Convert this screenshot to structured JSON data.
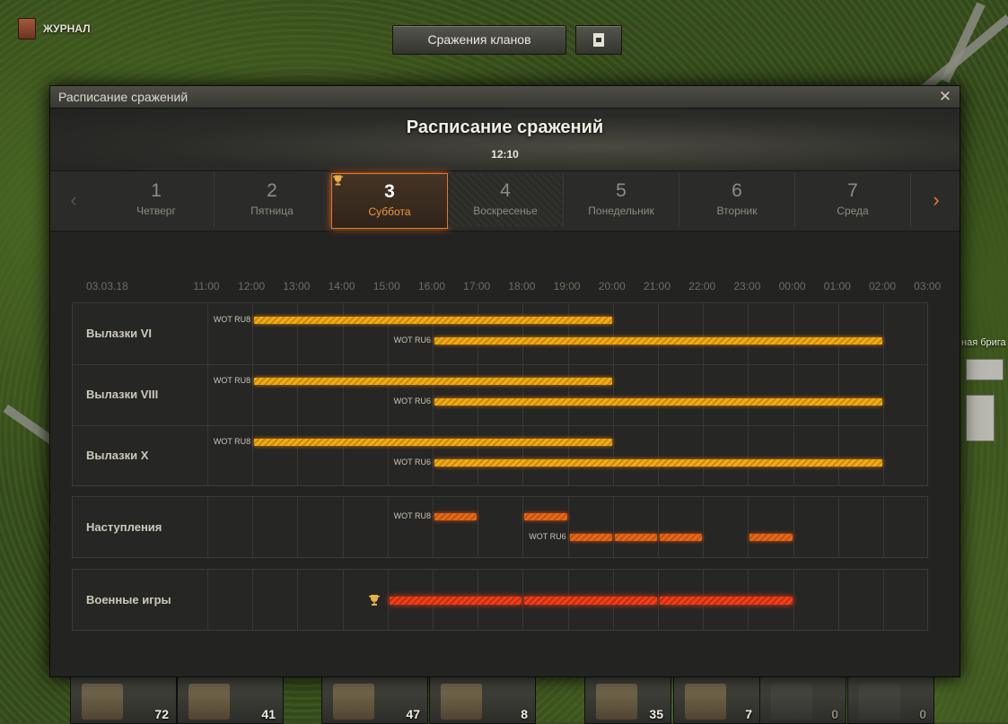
{
  "topbar": {
    "journal_label": "ЖУРНАЛ",
    "clan_battles_button": "Сражения кланов",
    "calendar_icon": "calendar-icon"
  },
  "side_text": "ная брига",
  "dialog": {
    "window_title": "Расписание сражений",
    "heading": "Расписание сражений",
    "time": "12:10",
    "close_icon": "close-icon",
    "days": [
      {
        "num": "1",
        "name": "Четверг"
      },
      {
        "num": "2",
        "name": "Пятница"
      },
      {
        "num": "3",
        "name": "Суббота",
        "selected": true,
        "trophy": true
      },
      {
        "num": "4",
        "name": "Воскресенье"
      },
      {
        "num": "5",
        "name": "Понедельник"
      },
      {
        "num": "6",
        "name": "Вторник"
      },
      {
        "num": "7",
        "name": "Среда"
      }
    ],
    "timeline": {
      "date": "03.03.18",
      "hours": [
        "11:00",
        "12:00",
        "13:00",
        "14:00",
        "15:00",
        "16:00",
        "17:00",
        "18:00",
        "19:00",
        "20:00",
        "21:00",
        "22:00",
        "23:00",
        "00:00",
        "01:00",
        "02:00",
        "03:00"
      ],
      "rows": [
        {
          "label": "Вылазки VI",
          "bars": [
            {
              "server": "WOT RU8",
              "start": "12:00",
              "end": "20:00"
            },
            {
              "server": "WOT RU6",
              "start": "16:00",
              "end": "02:00"
            }
          ]
        },
        {
          "label": "Вылазки VIII",
          "bars": [
            {
              "server": "WOT RU8",
              "start": "12:00",
              "end": "20:00"
            },
            {
              "server": "WOT RU6",
              "start": "16:00",
              "end": "02:00"
            }
          ]
        },
        {
          "label": "Вылазки X",
          "bars": [
            {
              "server": "WOT RU8",
              "start": "12:00",
              "end": "20:00"
            },
            {
              "server": "WOT RU6",
              "start": "16:00",
              "end": "02:00"
            }
          ]
        },
        {
          "label": "Наступления",
          "bars": [
            {
              "server": "WOT RU8",
              "start": "16:00",
              "end": "17:00"
            },
            {
              "server": "WOT RU8",
              "start": "18:00",
              "end": "19:00"
            },
            {
              "server": "WOT RU6",
              "start": "19:00",
              "end": "20:00"
            },
            {
              "server": "WOT RU6",
              "start": "20:00",
              "end": "21:00"
            },
            {
              "server": "WOT RU6",
              "start": "21:00",
              "end": "22:00"
            },
            {
              "server": "WOT RU6",
              "start": "23:00",
              "end": "00:00"
            }
          ]
        },
        {
          "label": "Военные игры",
          "bars": [
            {
              "start": "15:00",
              "end": "18:00"
            },
            {
              "start": "18:00",
              "end": "21:00"
            },
            {
              "start": "21:00",
              "end": "00:00"
            }
          ]
        }
      ],
      "labels": {
        "ru8": "WOT RU8",
        "ru6": "WOT RU6"
      }
    }
  },
  "tray": [
    {
      "count": "72"
    },
    {
      "count": "41"
    },
    {
      "count": "47"
    },
    {
      "count": "8"
    },
    {
      "count": "35"
    },
    {
      "count": "7"
    },
    {
      "count": "0",
      "dim": true
    },
    {
      "count": "0",
      "dim": true
    }
  ],
  "colors": {
    "accent": "#f27a24",
    "sorties": "#f0ad14",
    "advances": "#e86818",
    "war_games": "#f0401a"
  }
}
